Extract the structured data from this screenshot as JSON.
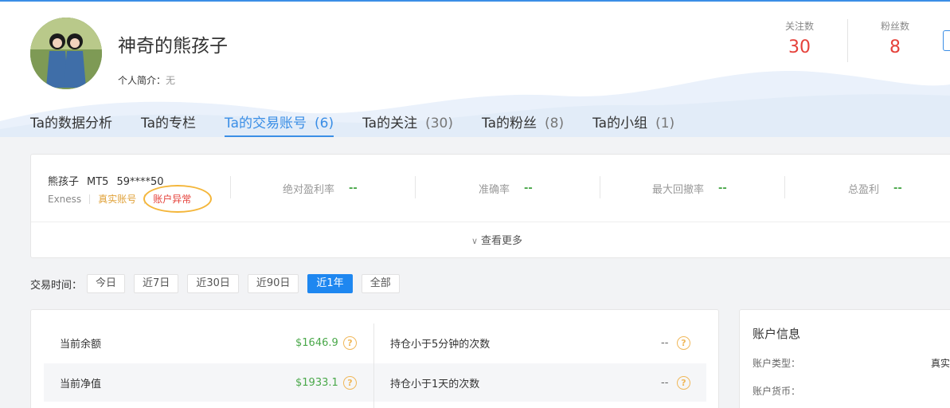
{
  "profile": {
    "username": "神奇的熊孩子",
    "intro_label": "个人简介：",
    "intro_value": "无"
  },
  "stats": {
    "following_label": "关注数",
    "following_value": "30",
    "followers_label": "粉丝数",
    "followers_value": "8"
  },
  "tabs": [
    {
      "label": "Ta的数据分析",
      "count": ""
    },
    {
      "label": "Ta的专栏",
      "count": ""
    },
    {
      "label": "Ta的交易账号",
      "count": "(6)"
    },
    {
      "label": "Ta的关注",
      "count": "(30)"
    },
    {
      "label": "Ta的粉丝",
      "count": "(8)"
    },
    {
      "label": "Ta的小组",
      "count": "(1)"
    }
  ],
  "account": {
    "name": "熊孩子",
    "platform": "MT5",
    "number": "59****50",
    "broker": "Exness",
    "type": "真实账号",
    "status": "账户异常",
    "metrics": [
      {
        "label": "绝对盈利率",
        "value": "--"
      },
      {
        "label": "准确率",
        "value": "--"
      },
      {
        "label": "最大回撤率",
        "value": "--"
      },
      {
        "label": "总盈利",
        "value": "--"
      }
    ],
    "more_label": "查看更多"
  },
  "time_filter": {
    "label": "交易时间：",
    "options": [
      "今日",
      "近7日",
      "近30日",
      "近90日",
      "近1年",
      "全部"
    ],
    "selected": "近1年"
  },
  "stat_rows": {
    "left": [
      {
        "label": "当前余额",
        "value": "$1646.9"
      },
      {
        "label": "当前净值",
        "value": "$1933.1"
      }
    ],
    "right": [
      {
        "label": "持仓小于5分钟的次数",
        "value": "--"
      },
      {
        "label": "持仓小于1天的次数",
        "value": "--"
      }
    ],
    "help_glyph": "?"
  },
  "account_info": {
    "title": "账户信息",
    "rows": [
      {
        "label": "账户类型：",
        "value": "真实"
      },
      {
        "label": "账户货币：",
        "value": ""
      }
    ]
  },
  "colors": {
    "accent": "#3a8ee6",
    "stat_red": "#e5413a",
    "positive_green": "#4aa84a",
    "real_account": "#e0a23a",
    "highlight_circle": "#f4b63a"
  }
}
